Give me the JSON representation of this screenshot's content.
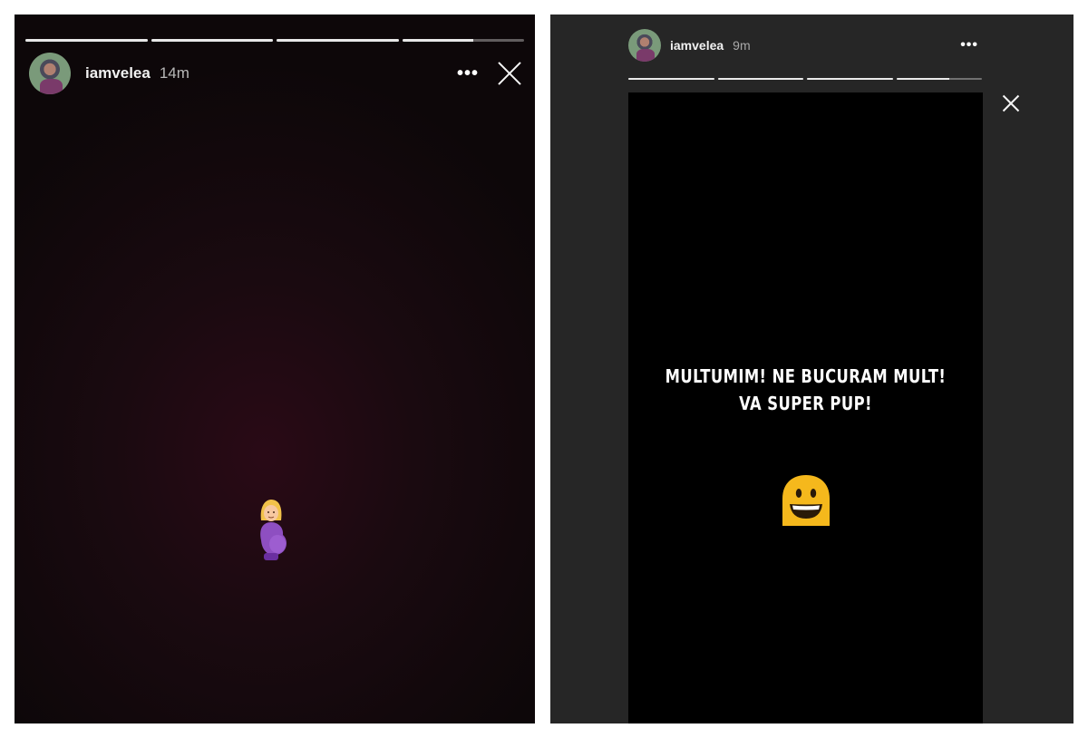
{
  "left_story": {
    "username": "iamvelea",
    "time": "14m",
    "more_label": "•••",
    "progress": [
      1,
      1,
      1,
      0.58
    ],
    "sticker_icon": "pregnant-woman-emoji"
  },
  "right_story": {
    "username": "iamvelea",
    "time": "9m",
    "more_label": "•••",
    "progress": [
      1,
      1,
      1,
      0.62
    ],
    "caption_line1": "MULTUMIM! NE BUCURAM MULT!",
    "caption_line2": "VA SUPER PUP!",
    "sticker_icon": "grinning-ghost-emoji"
  },
  "colors": {
    "right_background": "#262626",
    "story_background": "#000000",
    "emoji_yellow": "#f5b81c"
  }
}
